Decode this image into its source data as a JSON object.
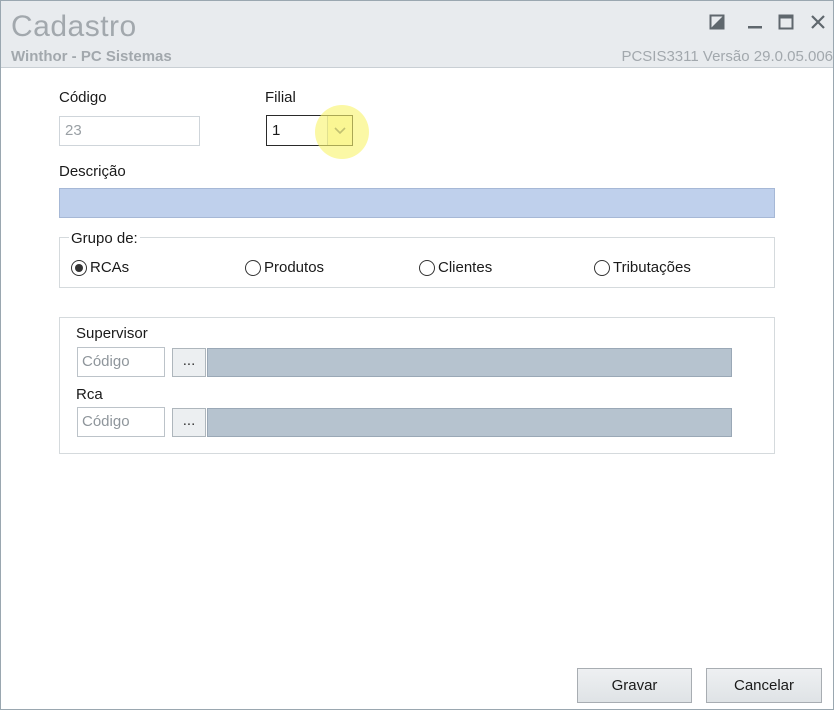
{
  "window": {
    "title": "Cadastro",
    "subtitle": "Winthor - PC Sistemas",
    "version_info": "PCSIS3311  Versão  29.0.05.006"
  },
  "window_controls": [
    "restore-icon",
    "minimize-icon",
    "maximize-icon",
    "close-icon"
  ],
  "form": {
    "codigo_label": "Código",
    "codigo_value": "23",
    "filial_label": "Filial",
    "filial_value": "1",
    "descricao_label": "Descrição",
    "descricao_value": "",
    "grupo_label": "Grupo de:",
    "grupo_options": [
      {
        "label": "RCAs",
        "selected": true
      },
      {
        "label": "Produtos",
        "selected": false
      },
      {
        "label": "Clientes",
        "selected": false
      },
      {
        "label": "Tributações",
        "selected": false
      }
    ],
    "supervisor_label": "Supervisor",
    "supervisor_code_placeholder": "Código",
    "rca_label": "Rca",
    "rca_code_placeholder": "Código",
    "lookup_button_label": "..."
  },
  "footer": {
    "save_label": "Gravar",
    "cancel_label": "Cancelar"
  },
  "colors": {
    "description_field": "#bfd0ec",
    "readonly_field": "#b6c3cf",
    "highlight": "#f8f46e"
  }
}
